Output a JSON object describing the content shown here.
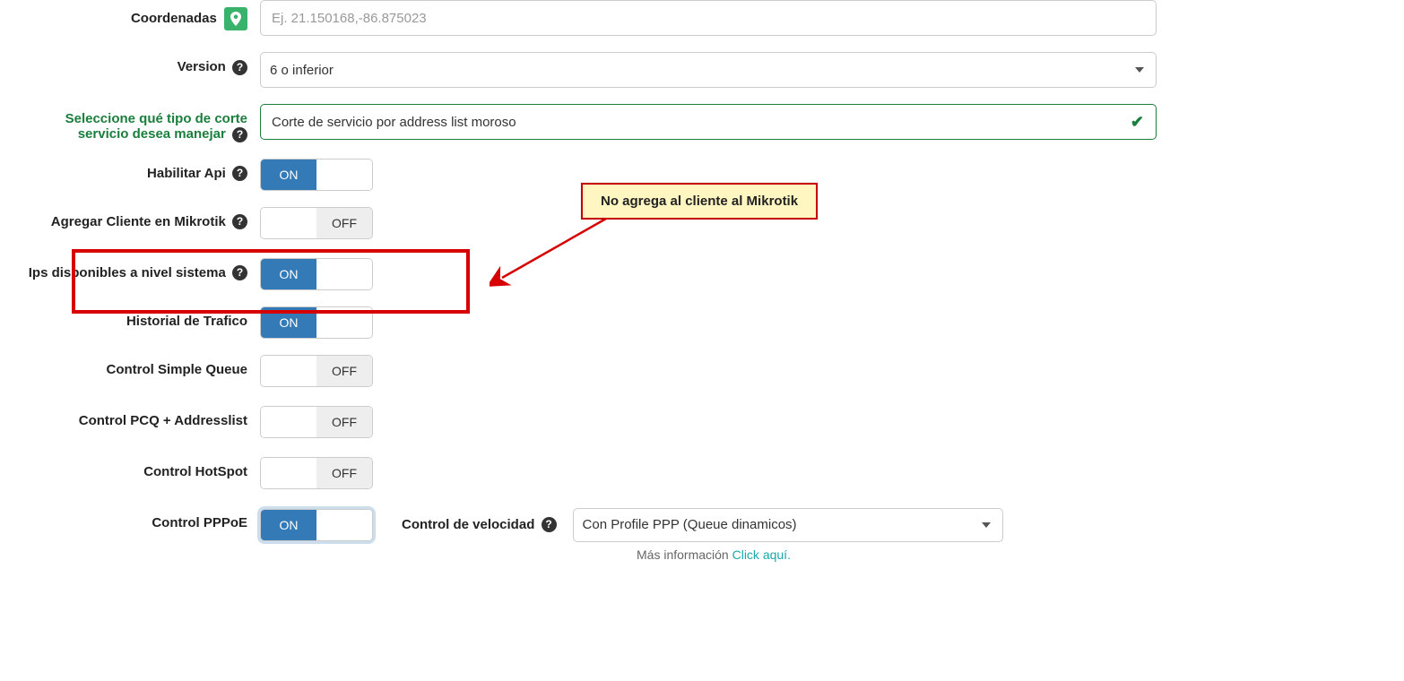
{
  "labels": {
    "coordenadas": "Coordenadas",
    "version": "Version",
    "tipo_corte": "Seleccione qué tipo de corte servicio desea manejar",
    "habilitar_api": "Habilitar Api",
    "agregar_cliente": "Agregar Cliente en Mikrotik",
    "ips_disponibles": "Ips disponibles a nivel sistema",
    "historial": "Historial de Trafico",
    "control_simple_queue": "Control Simple Queue",
    "control_pcq": "Control PCQ + Addresslist",
    "control_hotspot": "Control HotSpot",
    "control_pppoe": "Control PPPoE",
    "control_velocidad": "Control de velocidad"
  },
  "coordenadas": {
    "placeholder": "Ej. 21.150168,-86.875023",
    "value": ""
  },
  "version_selected": "6 o inferior",
  "tipo_corte_selected": "Corte de servicio por address list moroso",
  "toggle_on": "ON",
  "toggle_off": "OFF",
  "callout_text": "No agrega al cliente al Mikrotik",
  "control_velocidad_selected": "Con Profile PPP (Queue dinamicos)",
  "helper_prefix": "Más información ",
  "helper_link": "Click aquí."
}
